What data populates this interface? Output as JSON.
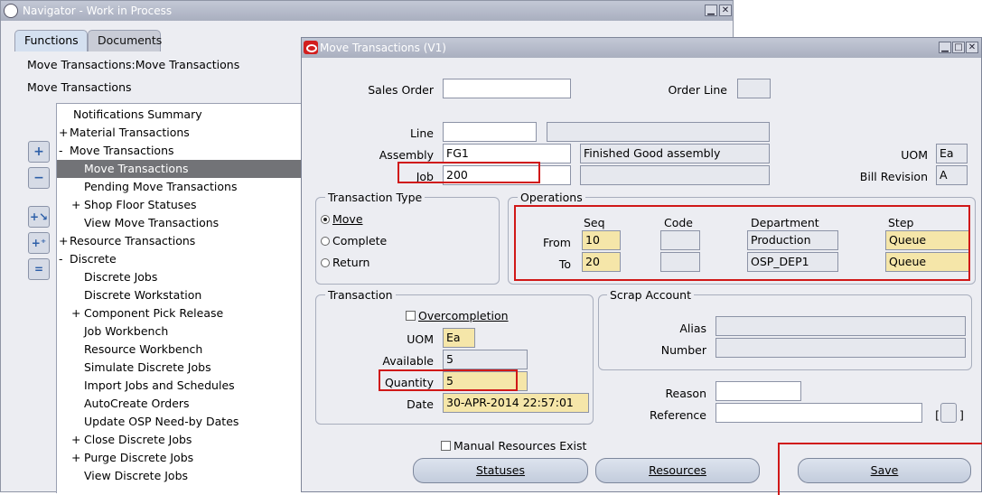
{
  "navigator": {
    "title": "Navigator - Work in Process",
    "tabs": [
      "Functions",
      "Documents"
    ],
    "path1": "Move Transactions:Move Transactions",
    "path2": "Move Transactions",
    "tree": [
      {
        "prefix": "",
        "label": "Notifications Summary",
        "indent": 1
      },
      {
        "prefix": "+",
        "label": "Material Transactions",
        "indent": 0
      },
      {
        "prefix": "-",
        "label": "Move Transactions",
        "indent": 0
      },
      {
        "prefix": "",
        "label": "Move Transactions",
        "indent": 2,
        "selected": true
      },
      {
        "prefix": "",
        "label": "Pending Move Transactions",
        "indent": 2
      },
      {
        "prefix": "+",
        "label": "Shop Floor Statuses",
        "indent": 1
      },
      {
        "prefix": "",
        "label": "View Move Transactions",
        "indent": 2
      },
      {
        "prefix": "+",
        "label": "Resource Transactions",
        "indent": 0
      },
      {
        "prefix": "-",
        "label": "Discrete",
        "indent": 0
      },
      {
        "prefix": "",
        "label": "Discrete Jobs",
        "indent": 2
      },
      {
        "prefix": "",
        "label": "Discrete Workstation",
        "indent": 2
      },
      {
        "prefix": "+",
        "label": "Component Pick Release",
        "indent": 1
      },
      {
        "prefix": "",
        "label": "Job Workbench",
        "indent": 2
      },
      {
        "prefix": "",
        "label": "Resource Workbench",
        "indent": 2
      },
      {
        "prefix": "",
        "label": "Simulate Discrete Jobs",
        "indent": 2
      },
      {
        "prefix": "",
        "label": "Import Jobs and Schedules",
        "indent": 2
      },
      {
        "prefix": "",
        "label": "AutoCreate Orders",
        "indent": 2
      },
      {
        "prefix": "",
        "label": "Update OSP Need-by Dates",
        "indent": 2
      },
      {
        "prefix": "+",
        "label": "Close Discrete Jobs",
        "indent": 1
      },
      {
        "prefix": "+",
        "label": "Purge Discrete Jobs",
        "indent": 1
      },
      {
        "prefix": "",
        "label": "View Discrete Jobs",
        "indent": 2
      }
    ]
  },
  "move": {
    "title": "Move Transactions (V1)",
    "sales_order_label": "Sales Order",
    "sales_order": "",
    "order_line_label": "Order Line",
    "order_line": "",
    "line_label": "Line",
    "line": "",
    "line_desc": "",
    "assembly_label": "Assembly",
    "assembly": "FG1",
    "assembly_desc": "Finished Good assembly",
    "job_label": "Job",
    "job": "200",
    "job_desc": "",
    "uom_label": "UOM",
    "uom": "Ea",
    "bill_rev_label": "Bill Revision",
    "bill_rev": "A",
    "txn_type_label": "Transaction Type",
    "radio_move": "Move",
    "radio_complete": "Complete",
    "radio_return": "Return",
    "ops_label": "Operations",
    "ops_headers": {
      "seq": "Seq",
      "code": "Code",
      "dept": "Department",
      "step": "Step"
    },
    "from_label": "From",
    "to_label": "To",
    "from": {
      "seq": "10",
      "code": "",
      "dept": "Production",
      "step": "Queue"
    },
    "to": {
      "seq": "20",
      "code": "",
      "dept": "OSP_DEP1",
      "step": "Queue"
    },
    "txn_label": "Transaction",
    "overcompletion": "Overcompletion",
    "txn_uom_label": "UOM",
    "txn_uom": "Ea",
    "available_label": "Available",
    "available": "5",
    "quantity_label": "Quantity",
    "quantity": "5",
    "date_label": "Date",
    "date": "30-APR-2014 22:57:01",
    "scrap_label": "Scrap Account",
    "alias_label": "Alias",
    "number_label": "Number",
    "reason_label": "Reason",
    "reference_label": "Reference",
    "bracket": "[",
    "manual_resources": "Manual Resources Exist",
    "statuses_btn": "Statuses",
    "resources_btn": "Resources",
    "save_btn": "Save"
  }
}
